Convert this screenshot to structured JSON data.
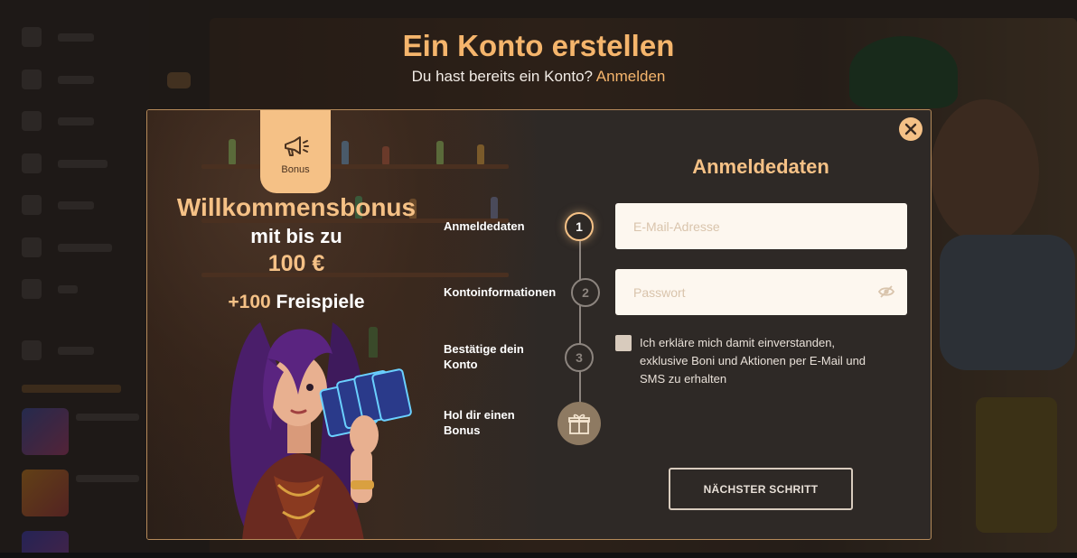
{
  "page": {
    "headline": "Ein Konto erstellen",
    "subline_text": "Du hast bereits ein Konto?",
    "subline_link": "Anmelden"
  },
  "promo": {
    "tag_label": "Bonus",
    "title": "Willkommensbonus",
    "line2": "mit bis zu",
    "amount": "100 €",
    "spins_prefix": "+100",
    "spins_suffix": "Freispiele"
  },
  "steps": [
    {
      "label": "Anmeldedaten",
      "number": "1",
      "state": "active"
    },
    {
      "label": "Kontoinformationen",
      "number": "2",
      "state": "inactive"
    },
    {
      "label": "Bestätige dein Konto",
      "number": "3",
      "state": "inactive"
    },
    {
      "label": "Hol dir einen Bonus",
      "icon": "gift-icon"
    }
  ],
  "form": {
    "title": "Anmeldedaten",
    "email_placeholder": "E-Mail-Adresse",
    "password_placeholder": "Passwort",
    "consent_text": "Ich erkläre mich damit einverstanden, exklusive Boni und Aktionen per E-Mail und SMS zu erhalten",
    "next_button": "NÄCHSTER SCHRITT"
  },
  "colors": {
    "accent": "#f5c186",
    "headline": "#f5b56c",
    "modal_bg": "#2e2926",
    "field_bg": "#fdf7ef"
  }
}
